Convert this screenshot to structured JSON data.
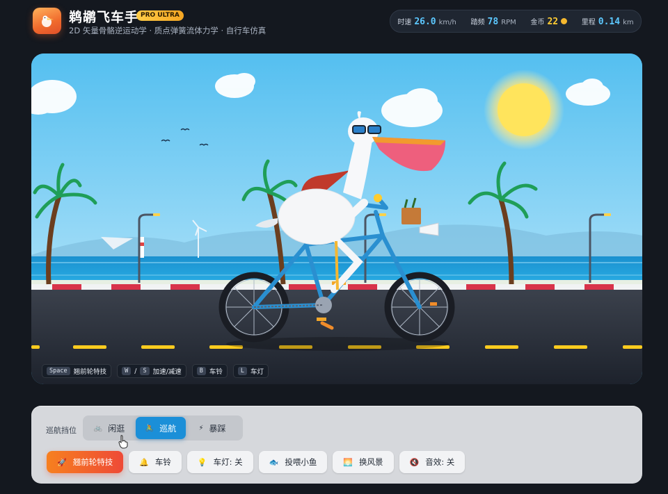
{
  "header": {
    "title": "鹈鹕飞车手",
    "badge": "PRO ULTRA",
    "subtitle": "2D 矢量骨骼逆运动学 · 质点弹簧流体力学 · 自行车仿真"
  },
  "stats": {
    "speed_label": "时速",
    "speed_value": "26.0",
    "speed_unit": "km/h",
    "cadence_label": "踏频",
    "cadence_value": "78",
    "cadence_unit": "RPM",
    "coins_label": "金币",
    "coins_value": "22",
    "distance_label": "里程",
    "distance_value": "0.14",
    "distance_unit": "km"
  },
  "key_hints": [
    {
      "key": "Space",
      "label": "翘前轮特技"
    },
    {
      "key": "W",
      "sep": "/",
      "key2": "S",
      "label": "加速/减速"
    },
    {
      "key": "B",
      "label": "车铃"
    },
    {
      "key": "L",
      "label": "车灯"
    }
  ],
  "panel": {
    "gear_label": "巡航挡位",
    "gears": [
      {
        "icon": "🚲",
        "label": "闲逛",
        "active": false
      },
      {
        "icon": "🚴",
        "label": "巡航",
        "active": true
      },
      {
        "icon": "⚡",
        "label": "暴踩",
        "active": false
      }
    ],
    "actions": [
      {
        "icon": "🚀",
        "label": "翘前轮特技"
      },
      {
        "icon": "🔔",
        "label": "车铃"
      },
      {
        "icon": "💡",
        "label": "车灯: 关"
      },
      {
        "icon": "🐟",
        "label": "投喂小鱼"
      },
      {
        "icon": "🌅",
        "label": "换风景"
      },
      {
        "icon": "🔇",
        "label": "音效: 关"
      }
    ]
  },
  "colors": {
    "accent": "#1b8fd8",
    "primary_action": "#ee4a37",
    "stat_value": "#5cc8ff",
    "coin": "#ffcc33",
    "sky": "#5cc2f0",
    "sea": "#1d9fd6",
    "road": "#3a404b"
  }
}
